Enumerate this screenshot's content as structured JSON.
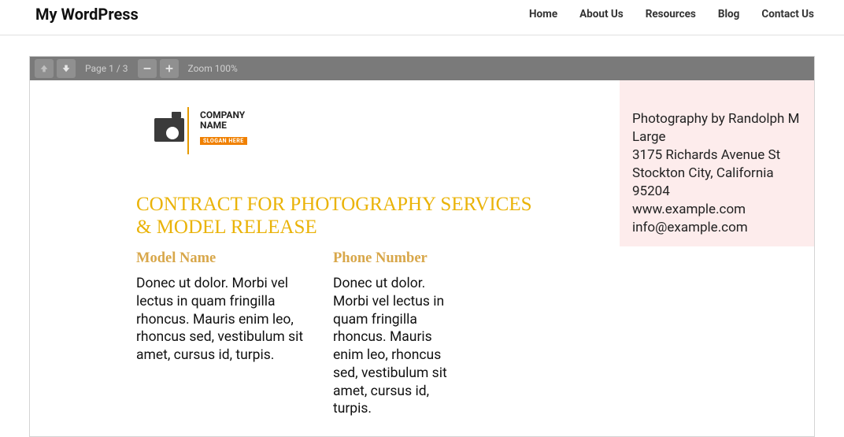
{
  "header": {
    "site_title": "My WordPress",
    "nav": [
      "Home",
      "About Us",
      "Resources",
      "Blog",
      "Contact Us"
    ]
  },
  "toolbar": {
    "page_label": "Page 1 / 3",
    "zoom_label": "Zoom 100%"
  },
  "logo": {
    "line1": "COMPANY",
    "line2": "NAME",
    "slogan": "SLOGAN HERE"
  },
  "doc_title": "CONTRACT FOR PHOTOGRAPHY SERVICES & MODEL RELEASE",
  "fields": {
    "model_name": {
      "label": "Model Name",
      "value": "Donec ut dolor. Morbi vel lectus in quam fringilla rhoncus. Mauris enim leo, rhoncus sed, vestibulum sit amet, cursus id, turpis."
    },
    "phone": {
      "label": "Phone Number",
      "value": "Donec ut dolor. Morbi vel lectus in quam fringilla rhoncus. Mauris enim leo, rhoncus sed, vestibulum sit amet, cursus id, turpis."
    }
  },
  "sidebar": {
    "line1": "Photography by Randolph M Large",
    "line2": "3175 Richards Avenue St",
    "line3": "Stockton City, California 95204",
    "line4": "www.example.com",
    "line5": "info@example.com"
  }
}
